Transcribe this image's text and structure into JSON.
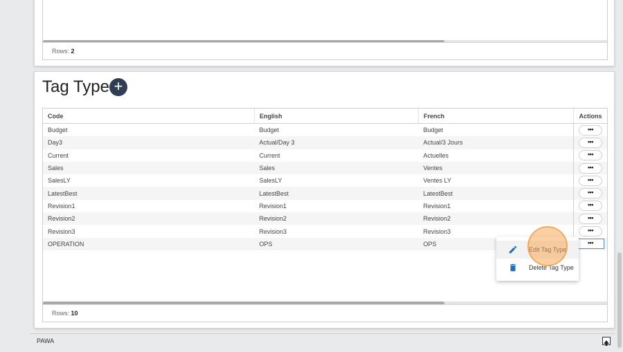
{
  "top_grid": {
    "rows_label": "Rows:",
    "rows_count": "2"
  },
  "section": {
    "title": "Tag Type",
    "add_icon": "plus-icon"
  },
  "table": {
    "columns": [
      "Code",
      "English",
      "French",
      "Actions"
    ],
    "rows": [
      {
        "code": "Budget",
        "english": "Budget",
        "french": "Budget"
      },
      {
        "code": "Day3",
        "english": "Actual/Day 3",
        "french": "Actual/3 Jours"
      },
      {
        "code": "Current",
        "english": "Current",
        "french": "Actuelles"
      },
      {
        "code": "Sales",
        "english": "Sales",
        "french": "Ventes"
      },
      {
        "code": "SalesLY",
        "english": "SalesLY",
        "french": "Ventes LY"
      },
      {
        "code": "LatestBest",
        "english": "LatestBest",
        "french": "LatestBest"
      },
      {
        "code": "Revision1",
        "english": "Revision1",
        "french": "Revision1"
      },
      {
        "code": "Revision2",
        "english": "Revision2",
        "french": "Revision2"
      },
      {
        "code": "Revision3",
        "english": "Revision3",
        "french": "Revision3"
      },
      {
        "code": "OPERATION",
        "english": "OPS",
        "french": "OPS"
      }
    ],
    "action_label": "•••",
    "rows_label": "Rows:",
    "rows_count": "10"
  },
  "context_menu": {
    "items": [
      {
        "label": "Edit Tag Type",
        "icon": "pencil-icon"
      },
      {
        "label": "Delete Tag Type",
        "icon": "trash-icon"
      }
    ]
  },
  "footer": {
    "app_name": "PAWA",
    "scroll_top_icon": "arrow-up-icon"
  },
  "colors": {
    "accent": "#2f3e55",
    "icon_blue": "#1e6fb8",
    "highlight": "#f7aa5a"
  }
}
